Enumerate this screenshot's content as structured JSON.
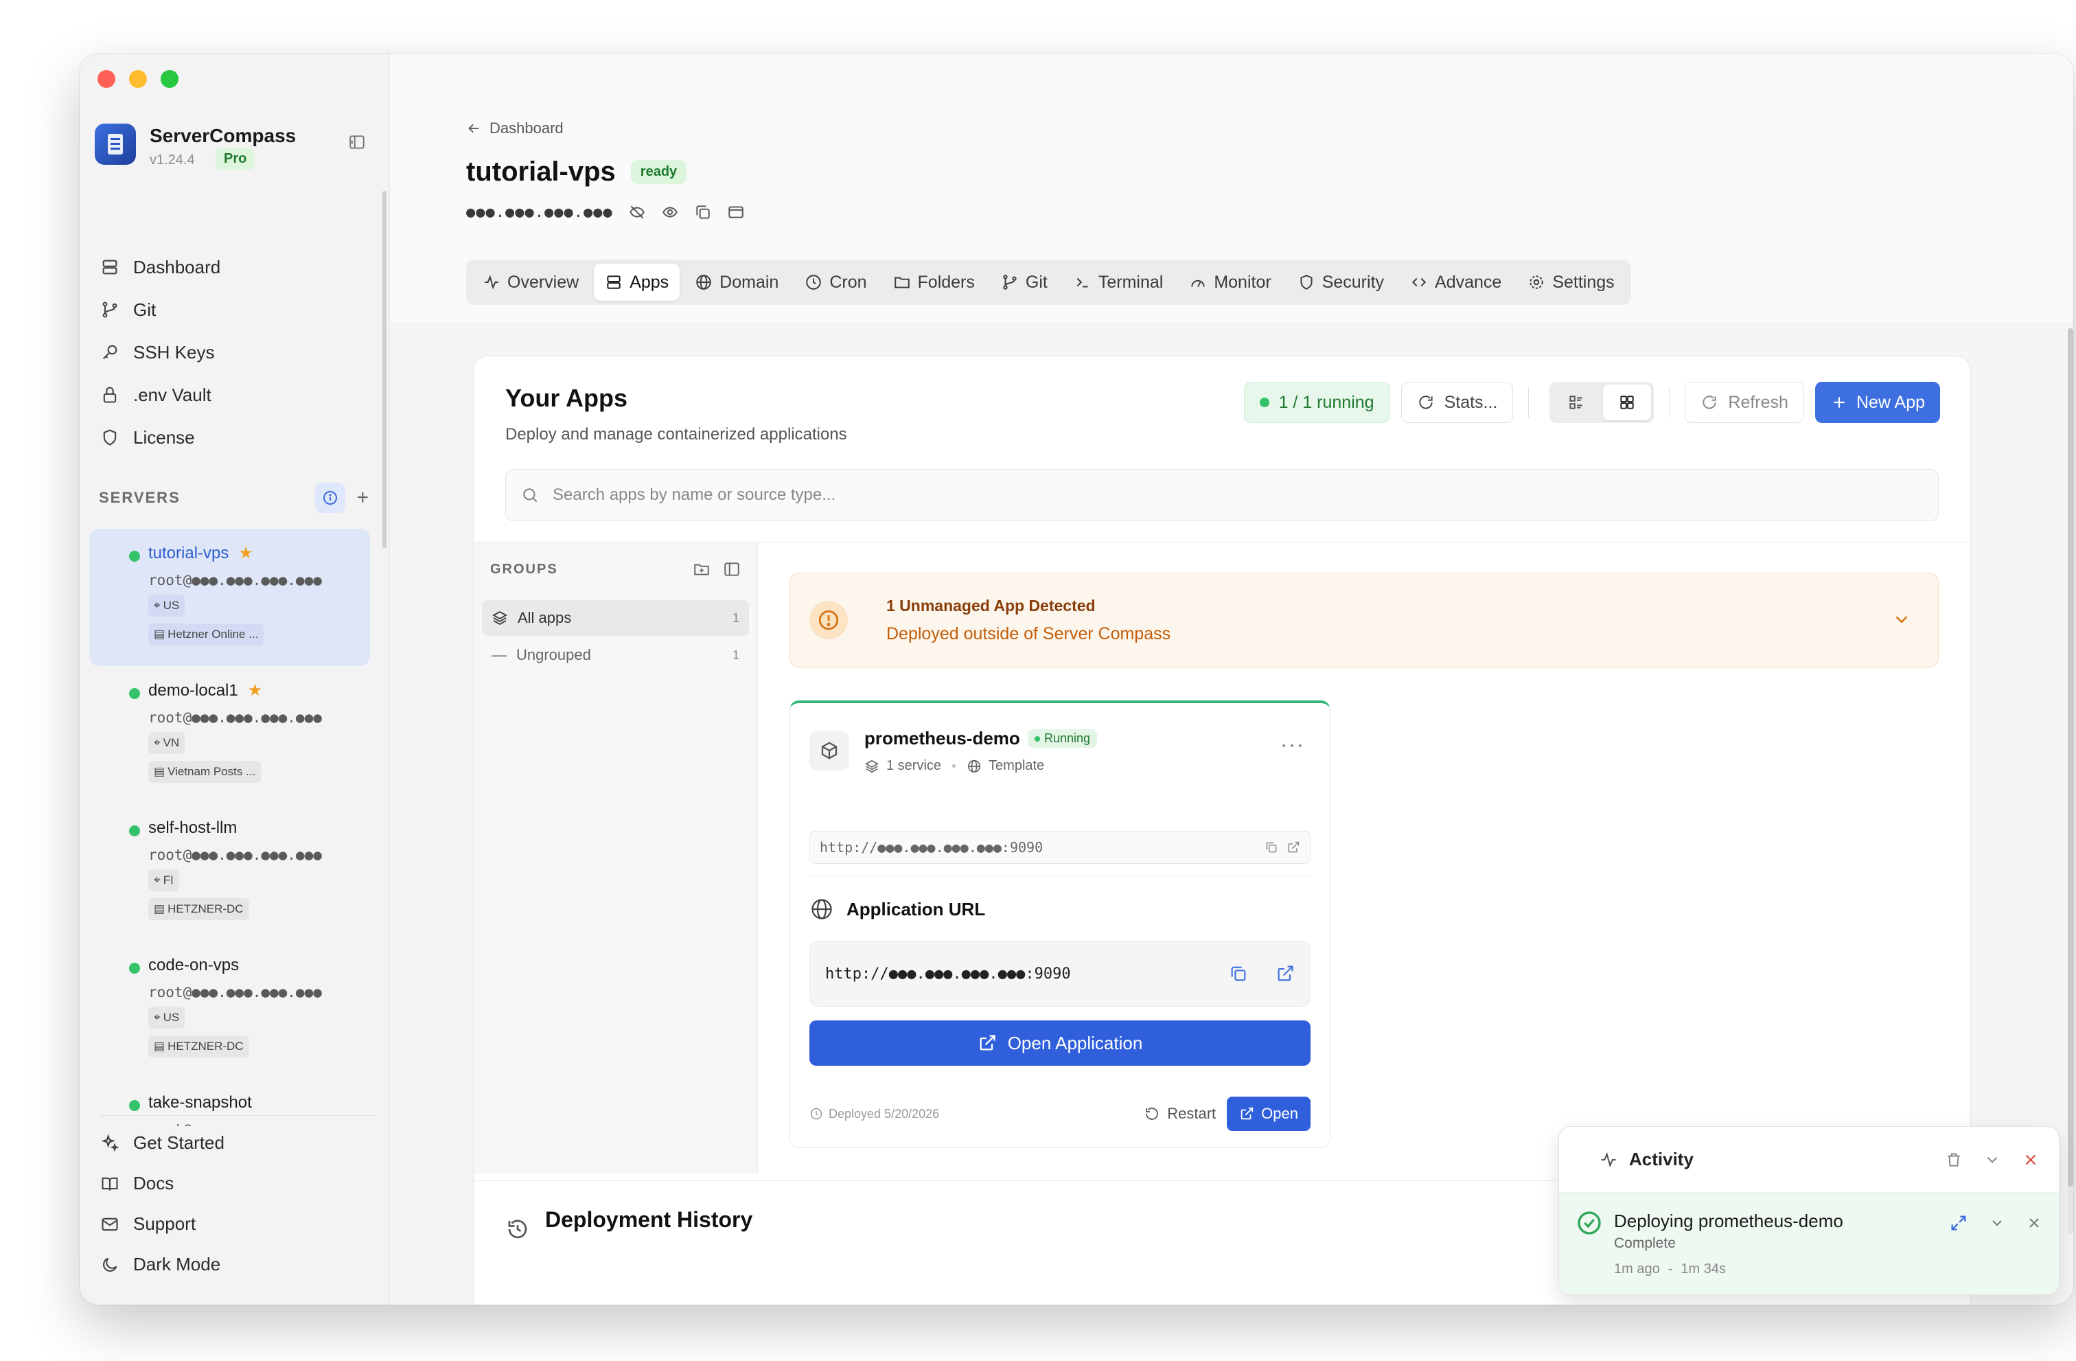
{
  "app": {
    "name": "ServerCompass",
    "version": "v1.24.4",
    "plan": "Pro"
  },
  "nav": {
    "items": [
      {
        "label": "Dashboard",
        "icon": "dashboard-icon"
      },
      {
        "label": "Git",
        "icon": "git-branch-icon"
      },
      {
        "label": "SSH Keys",
        "icon": "key-icon"
      },
      {
        "label": ".env Vault",
        "icon": "lock-icon"
      },
      {
        "label": "License",
        "icon": "shield-icon"
      }
    ]
  },
  "servers": {
    "heading": "SERVERS",
    "items": [
      {
        "name": "tutorial-vps",
        "starred": true,
        "address": "root@●●●.●●●.●●●.●●●",
        "region": "US",
        "provider": "Hetzner Online ...",
        "active": true
      },
      {
        "name": "demo-local1",
        "starred": true,
        "address": "root@●●●.●●●.●●●.●●●",
        "region": "VN",
        "provider": "Vietnam Posts ...",
        "active": false
      },
      {
        "name": "self-host-llm",
        "starred": false,
        "address": "root@●●●.●●●.●●●.●●●",
        "region": "FI",
        "provider": "HETZNER-DC",
        "active": false
      },
      {
        "name": "code-on-vps",
        "starred": false,
        "address": "root@●●●.●●●.●●●.●●●",
        "region": "US",
        "provider": "HETZNER-DC",
        "active": false
      },
      {
        "name": "take-snapshot",
        "starred": false,
        "address": "root@●●●.●●●.●●●.●●●",
        "region": "",
        "provider": "",
        "active": false
      }
    ]
  },
  "bottom_nav": {
    "items": [
      {
        "label": "Get Started",
        "icon": "sparkles-icon"
      },
      {
        "label": "Docs",
        "icon": "book-icon"
      },
      {
        "label": "Support",
        "icon": "mail-icon"
      },
      {
        "label": "Dark Mode",
        "icon": "moon-icon"
      }
    ]
  },
  "header": {
    "breadcrumb": "Dashboard",
    "title": "tutorial-vps",
    "status": "ready",
    "ip": "●●●.●●●.●●●.●●●"
  },
  "tabs": [
    {
      "label": "Overview",
      "icon": "activity-icon",
      "active": false
    },
    {
      "label": "Apps",
      "icon": "server-stack-icon",
      "active": true
    },
    {
      "label": "Domain",
      "icon": "globe-icon",
      "active": false
    },
    {
      "label": "Cron",
      "icon": "clock-icon",
      "active": false
    },
    {
      "label": "Folders",
      "icon": "folder-icon",
      "active": false
    },
    {
      "label": "Git",
      "icon": "git-branch-icon",
      "active": false
    },
    {
      "label": "Terminal",
      "icon": "terminal-icon",
      "active": false
    },
    {
      "label": "Monitor",
      "icon": "gauge-icon",
      "active": false
    },
    {
      "label": "Security",
      "icon": "shield-icon",
      "active": false
    },
    {
      "label": "Advance",
      "icon": "code-icon",
      "active": false
    },
    {
      "label": "Settings",
      "icon": "gear-icon",
      "active": false
    }
  ],
  "apps": {
    "title": "Your Apps",
    "subtitle": "Deploy and manage containerized applications",
    "running": "1 / 1 running",
    "stats_label": "Stats...",
    "refresh_label": "Refresh",
    "new_app_label": "New App",
    "search_placeholder": "Search apps by name or source type..."
  },
  "groups": {
    "heading": "GROUPS",
    "items": [
      {
        "label": "All apps",
        "count": "1"
      },
      {
        "label": "Ungrouped",
        "count": "1"
      }
    ]
  },
  "unmanaged": {
    "title": "1 Unmanaged App Detected",
    "subtitle": "Deployed outside of Server Compass"
  },
  "app_card": {
    "name": "prometheus-demo",
    "status": "Running",
    "services": "1 service",
    "source": "Template",
    "url_small": "http://●●●.●●●.●●●.●●●:9090",
    "url_label": "Application URL",
    "url": "http://●●●.●●●.●●●.●●●:9090",
    "open_app_label": "Open Application",
    "deployed": "Deployed 5/20/2026",
    "restart_label": "Restart",
    "open_label": "Open"
  },
  "deployment_history": {
    "title": "Deployment History"
  },
  "activity": {
    "title": "Activity",
    "item_title": "Deploying prometheus-demo",
    "item_status": "Complete",
    "item_time": "1m ago",
    "item_sep": "-",
    "item_duration": "1m 34s"
  },
  "colors": {
    "accent": "#3d6fe0",
    "success": "#34c26a",
    "warning": "#d87411",
    "danger": "#e0493f"
  }
}
